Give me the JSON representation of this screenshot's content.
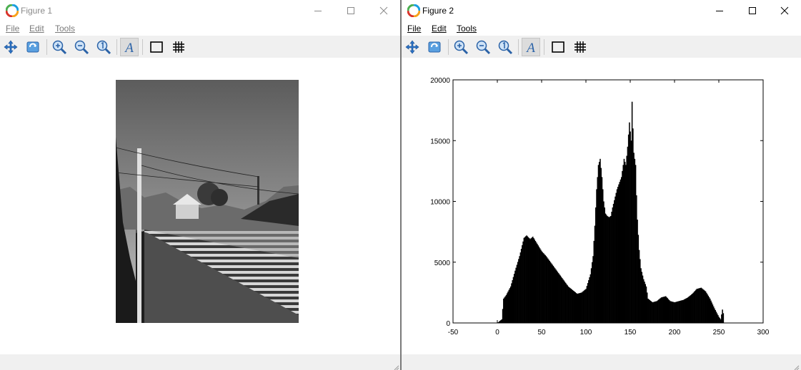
{
  "figure1": {
    "title": "Figure 1",
    "menu": {
      "file": "File",
      "edit": "Edit",
      "tools": "Tools"
    },
    "image_caption": "grayscale photograph: rooftop, utility pole with wires, trees and sky"
  },
  "figure2": {
    "title": "Figure 2",
    "menu": {
      "file": "File",
      "edit": "Edit",
      "tools": "Tools"
    }
  },
  "toolbar_tools": [
    "pan-icon",
    "rotate-icon",
    "zoom-in-icon",
    "zoom-out-icon",
    "zoom-reset-icon",
    "text-insert-icon",
    "axes-box-icon",
    "grid-icon"
  ],
  "colors": {
    "bars": "#000000",
    "toolbar_bg": "#f0f0f0",
    "accent_logo": "#1a9fe0"
  },
  "chart_data": {
    "type": "bar",
    "title": "",
    "xlabel": "",
    "ylabel": "",
    "xlim": [
      -50,
      300
    ],
    "ylim": [
      0,
      20000
    ],
    "xticks": [
      -50,
      0,
      50,
      100,
      150,
      200,
      250,
      300
    ],
    "yticks": [
      0,
      5000,
      10000,
      15000,
      20000
    ],
    "grid": false,
    "x": [
      0,
      5,
      7,
      10,
      15,
      20,
      25,
      30,
      33,
      37,
      40,
      45,
      50,
      55,
      60,
      65,
      70,
      75,
      80,
      85,
      90,
      95,
      100,
      105,
      108,
      110,
      112,
      114,
      116,
      118,
      120,
      122,
      124,
      126,
      128,
      130,
      135,
      140,
      143,
      145,
      147,
      149,
      151,
      152,
      153,
      154,
      155,
      156,
      157,
      158,
      160,
      162,
      165,
      168,
      170,
      175,
      180,
      185,
      190,
      195,
      200,
      205,
      210,
      215,
      220,
      225,
      230,
      235,
      240,
      245,
      250,
      252,
      254,
      255
    ],
    "values": [
      0,
      300,
      2000,
      2300,
      3000,
      4300,
      5500,
      7000,
      7200,
      6900,
      7100,
      6500,
      5900,
      5500,
      5000,
      4500,
      4000,
      3500,
      3000,
      2700,
      2400,
      2500,
      2800,
      4000,
      5500,
      8000,
      11000,
      13000,
      13500,
      12000,
      10000,
      9000,
      8800,
      8700,
      8800,
      9500,
      11000,
      12000,
      13500,
      13000,
      14500,
      16500,
      15000,
      18200,
      16000,
      14000,
      13500,
      13000,
      10500,
      8500,
      6000,
      4500,
      3600,
      3000,
      2000,
      1700,
      1800,
      2100,
      2200,
      1800,
      1700,
      1800,
      1900,
      2100,
      2400,
      2800,
      2900,
      2600,
      2000,
      1200,
      500,
      300,
      1100,
      800
    ]
  }
}
